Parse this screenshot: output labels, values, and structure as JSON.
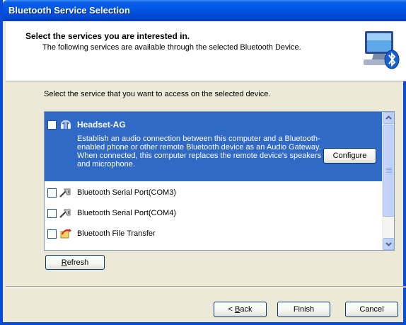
{
  "window": {
    "title": "Bluetooth Service Selection"
  },
  "header": {
    "title": "Select the services you are interested in.",
    "subtitle": "The following services are available through the selected Bluetooth Device.",
    "icon": "computer-bluetooth-icon"
  },
  "instruction": "Select the service that you want to access on the selected device.",
  "services": {
    "selected": {
      "name": "Headset-AG",
      "checked": false,
      "icon": "headset-icon",
      "description": "Establish an audio connection between this computer and a Bluetooth-enabled phone or other remote Bluetooth device as an Audio Gateway. When connected, this computer replaces the remote device's speakers and microphone.",
      "configure_label": "Configure"
    },
    "items": [
      {
        "label": "Bluetooth Serial Port(COM3)",
        "checked": false,
        "icon": "serial-cable-icon"
      },
      {
        "label": "Bluetooth Serial Port(COM4)",
        "checked": false,
        "icon": "serial-cable-icon"
      },
      {
        "label": "Bluetooth File Transfer",
        "checked": false,
        "icon": "file-transfer-icon"
      }
    ]
  },
  "buttons": {
    "refresh": {
      "hotkey": "R",
      "rest": "efresh"
    },
    "back": {
      "prefix": "< ",
      "hotkey": "B",
      "rest": "ack"
    },
    "finish": "Finish",
    "cancel": "Cancel"
  },
  "colors": {
    "selection": "#3169c6",
    "titlebar": "#0054e3",
    "face": "#ece9d8"
  }
}
